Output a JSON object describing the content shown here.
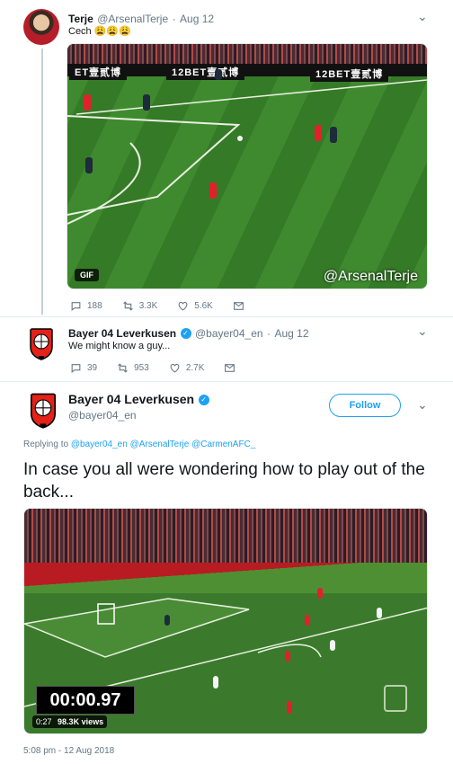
{
  "tweet1": {
    "name": "Terje",
    "handle": "@ArsenalTerje",
    "date": "Aug 12",
    "text": "Cech 😩😩😩",
    "media": {
      "badge": "GIF",
      "watermark": "@ArsenalTerje",
      "ads": [
        "ET壹贰博",
        "12BET壹贰博",
        "12BET壹贰博"
      ]
    },
    "actions": {
      "replies": "188",
      "retweets": "3.3K",
      "likes": "5.6K"
    }
  },
  "tweet2": {
    "name": "Bayer 04 Leverkusen",
    "handle": "@bayer04_en",
    "date": "Aug 12",
    "text": "We might know a guy...",
    "actions": {
      "replies": "39",
      "retweets": "953",
      "likes": "2.7K"
    }
  },
  "tweet3": {
    "name": "Bayer 04 Leverkusen",
    "handle": "@bayer04_en",
    "follow_label": "Follow",
    "replying_prefix": "Replying to",
    "replying_to": [
      "@bayer04_en",
      "@ArsenalTerje",
      "@CarmenAFC_"
    ],
    "text": "In case you all were wondering how to play out of the back...",
    "video": {
      "timer": "00:00.97",
      "duration": "0:27",
      "views": "98.3K views"
    },
    "timestamp": "5:08 pm - 12 Aug 2018"
  },
  "colors": {
    "accent": "#1da1f2",
    "muted": "#657786",
    "text": "#14171a"
  }
}
